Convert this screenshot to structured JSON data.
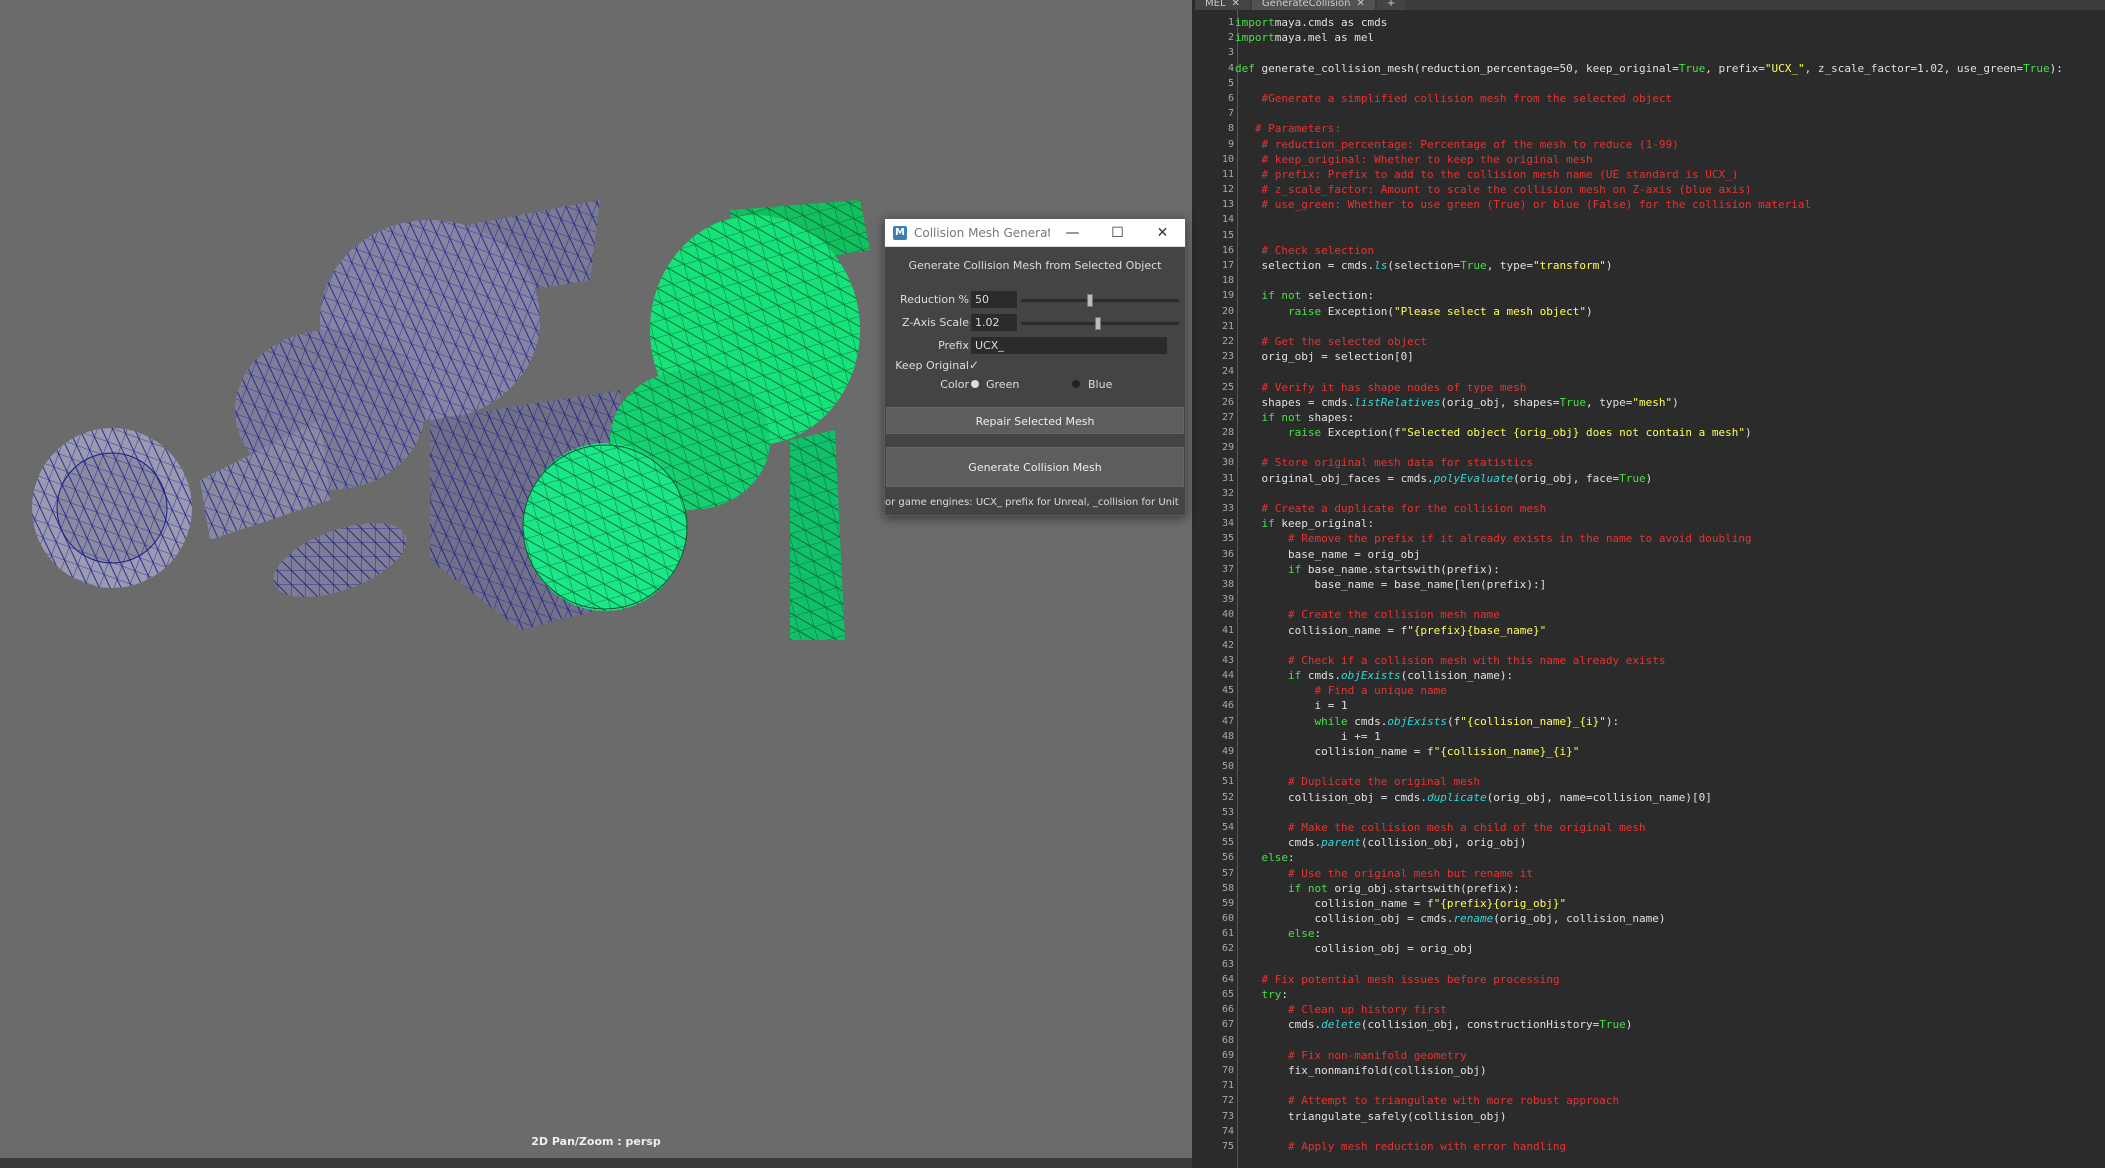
{
  "viewport": {
    "hud_text": "2D Pan/Zoom : persp"
  },
  "dialog": {
    "title": "Collision Mesh Generat...",
    "icon": "maya-icon",
    "header": "Generate Collision Mesh from Selected Object",
    "reduction": {
      "label": "Reduction %",
      "value": "50",
      "slider_fraction": 0.42
    },
    "zscale": {
      "label": "Z-Axis Scale",
      "value": "1.02",
      "slider_fraction": 0.47
    },
    "prefix": {
      "label": "Prefix",
      "value": "UCX_"
    },
    "keep_original": {
      "label": "Keep Original",
      "checked": true
    },
    "color": {
      "label": "Color",
      "options": [
        "Green",
        "Blue"
      ],
      "selected": "Green"
    },
    "repair_button": "Repair Selected Mesh",
    "generate_button": "Generate Collision Mesh",
    "footer": "or game engines: UCX_ prefix for Unreal, _collision for Unit"
  },
  "editor": {
    "tabs": [
      {
        "label": "MEL",
        "active": false
      },
      {
        "label": "GenerateCollision",
        "active": true
      }
    ],
    "add_tab": "+",
    "lines": [
      [
        [
          "k",
          "import"
        ],
        [
          "",
          "maya.cmds as cmds"
        ]
      ],
      [
        [
          "k",
          "import"
        ],
        [
          "",
          "maya.mel as mel"
        ]
      ],
      [],
      [
        [
          "k",
          "def"
        ],
        [
          "",
          " generate_collision_mesh(reduction_percentage=50, keep_original="
        ],
        [
          "k",
          "True"
        ],
        [
          "",
          ", prefix="
        ],
        [
          "s",
          "\"UCX_\""
        ],
        [
          "",
          ", z_scale_factor=1.02, use_green="
        ],
        [
          "k",
          "True"
        ],
        [
          "",
          "):"
        ]
      ],
      [],
      [
        [
          "c",
          "    #Generate a simplified collision mesh from the selected object"
        ]
      ],
      [],
      [
        [
          "c",
          "   # Parameters:"
        ]
      ],
      [
        [
          "c",
          "    # reduction_percentage: Percentage of the mesh to reduce (1-99)"
        ]
      ],
      [
        [
          "c",
          "    # keep_original: Whether to keep the original mesh"
        ]
      ],
      [
        [
          "c",
          "    # prefix: Prefix to add to the collision mesh name (UE standard is UCX_)"
        ]
      ],
      [
        [
          "c",
          "    # z_scale_factor: Amount to scale the collision mesh on Z-axis (blue axis)"
        ]
      ],
      [
        [
          "c",
          "    # use_green: Whether to use green (True) or blue (False) for the collision material"
        ]
      ],
      [],
      [],
      [
        [
          "c",
          "    # Check selection"
        ]
      ],
      [
        [
          "",
          "    selection = cmds."
        ],
        [
          "f",
          "ls"
        ],
        [
          "",
          "(selection="
        ],
        [
          "k",
          "True"
        ],
        [
          "",
          ", type="
        ],
        [
          "s",
          "\"transform\""
        ],
        [
          "",
          ")"
        ]
      ],
      [],
      [
        [
          "k",
          "    if not"
        ],
        [
          "",
          " selection:"
        ]
      ],
      [
        [
          "k",
          "        raise"
        ],
        [
          "",
          " Exception("
        ],
        [
          "s",
          "\"Please select a mesh object\""
        ],
        [
          "",
          ")"
        ]
      ],
      [],
      [
        [
          "c",
          "    # Get the selected object"
        ]
      ],
      [
        [
          "",
          "    orig_obj = selection[0]"
        ]
      ],
      [],
      [
        [
          "c",
          "    # Verify it has shape nodes of type mesh"
        ]
      ],
      [
        [
          "",
          "    shapes = cmds."
        ],
        [
          "f",
          "listRelatives"
        ],
        [
          "",
          "(orig_obj, shapes="
        ],
        [
          "k",
          "True"
        ],
        [
          "",
          ", type="
        ],
        [
          "s",
          "\"mesh\""
        ],
        [
          "",
          ")"
        ]
      ],
      [
        [
          "k",
          "    if not"
        ],
        [
          "",
          " shapes:"
        ]
      ],
      [
        [
          "k",
          "        raise"
        ],
        [
          "",
          " Exception(f"
        ],
        [
          "s",
          "\"Selected object {orig_obj} does not contain a mesh\""
        ],
        [
          "",
          ")"
        ]
      ],
      [],
      [
        [
          "c",
          "    # Store original mesh data for statistics"
        ]
      ],
      [
        [
          "",
          "    original_obj_faces = cmds."
        ],
        [
          "f",
          "polyEvaluate"
        ],
        [
          "",
          "(orig_obj, face="
        ],
        [
          "k",
          "True"
        ],
        [
          "",
          ")"
        ]
      ],
      [],
      [
        [
          "c",
          "    # Create a duplicate for the collision mesh"
        ]
      ],
      [
        [
          "k",
          "    if"
        ],
        [
          "",
          " keep_original:"
        ]
      ],
      [
        [
          "c",
          "        # Remove the prefix if it already exists in the name to avoid doubling"
        ]
      ],
      [
        [
          "",
          "        base_name = orig_obj"
        ]
      ],
      [
        [
          "k",
          "        if"
        ],
        [
          "",
          " base_name.startswith(prefix):"
        ]
      ],
      [
        [
          "",
          "            base_name = base_name[len(prefix):]"
        ]
      ],
      [],
      [
        [
          "c",
          "        # Create the collision mesh name"
        ]
      ],
      [
        [
          "",
          "        collision_name = f"
        ],
        [
          "s",
          "\"{prefix}{base_name}\""
        ]
      ],
      [],
      [
        [
          "c",
          "        # Check if a collision mesh with this name already exists"
        ]
      ],
      [
        [
          "k",
          "        if"
        ],
        [
          "",
          " cmds."
        ],
        [
          "f",
          "objExists"
        ],
        [
          "",
          "(collision_name):"
        ]
      ],
      [
        [
          "c",
          "            # Find a unique name"
        ]
      ],
      [
        [
          "",
          "            i = 1"
        ]
      ],
      [
        [
          "k",
          "            while"
        ],
        [
          "",
          " cmds."
        ],
        [
          "f",
          "objExists"
        ],
        [
          "",
          "(f"
        ],
        [
          "s",
          "\"{collision_name}_{i}\""
        ],
        [
          "",
          "):"
        ]
      ],
      [
        [
          "",
          "                i += 1"
        ]
      ],
      [
        [
          "",
          "            collision_name = f"
        ],
        [
          "s",
          "\"{collision_name}_{i}\""
        ]
      ],
      [],
      [
        [
          "c",
          "        # Duplicate the original mesh"
        ]
      ],
      [
        [
          "",
          "        collision_obj = cmds."
        ],
        [
          "f",
          "duplicate"
        ],
        [
          "",
          "(orig_obj, name=collision_name)[0]"
        ]
      ],
      [],
      [
        [
          "c",
          "        # Make the collision mesh a child of the original mesh"
        ]
      ],
      [
        [
          "",
          "        cmds."
        ],
        [
          "f",
          "parent"
        ],
        [
          "",
          "(collision_obj, orig_obj)"
        ]
      ],
      [
        [
          "k",
          "    else"
        ],
        [
          "",
          ":"
        ]
      ],
      [
        [
          "c",
          "        # Use the original mesh but rename it"
        ]
      ],
      [
        [
          "k",
          "        if not"
        ],
        [
          "",
          " orig_obj.startswith(prefix):"
        ]
      ],
      [
        [
          "",
          "            collision_name = f"
        ],
        [
          "s",
          "\"{prefix}{orig_obj}\""
        ]
      ],
      [
        [
          "",
          "            collision_obj = cmds."
        ],
        [
          "f",
          "rename"
        ],
        [
          "",
          "(orig_obj, collision_name)"
        ]
      ],
      [
        [
          "k",
          "        else"
        ],
        [
          "",
          ":"
        ]
      ],
      [
        [
          "",
          "            collision_obj = orig_obj"
        ]
      ],
      [],
      [
        [
          "c",
          "    # Fix potential mesh issues before processing"
        ]
      ],
      [
        [
          "k",
          "    try"
        ],
        [
          "",
          ":"
        ]
      ],
      [
        [
          "c",
          "        # Clean up history first"
        ]
      ],
      [
        [
          "",
          "        cmds."
        ],
        [
          "f",
          "delete"
        ],
        [
          "",
          "(collision_obj, constructionHistory="
        ],
        [
          "k",
          "True"
        ],
        [
          "",
          ")"
        ]
      ],
      [],
      [
        [
          "c",
          "        # Fix non-manifold geometry"
        ]
      ],
      [
        [
          "",
          "        fix_nonmanifold(collision_obj)"
        ]
      ],
      [],
      [
        [
          "c",
          "        # Attempt to triangulate with more robust approach"
        ]
      ],
      [
        [
          "",
          "        triangulate_safely(collision_obj)"
        ]
      ],
      [],
      [
        [
          "c",
          "        # Apply mesh reduction with error handling"
        ]
      ]
    ]
  }
}
